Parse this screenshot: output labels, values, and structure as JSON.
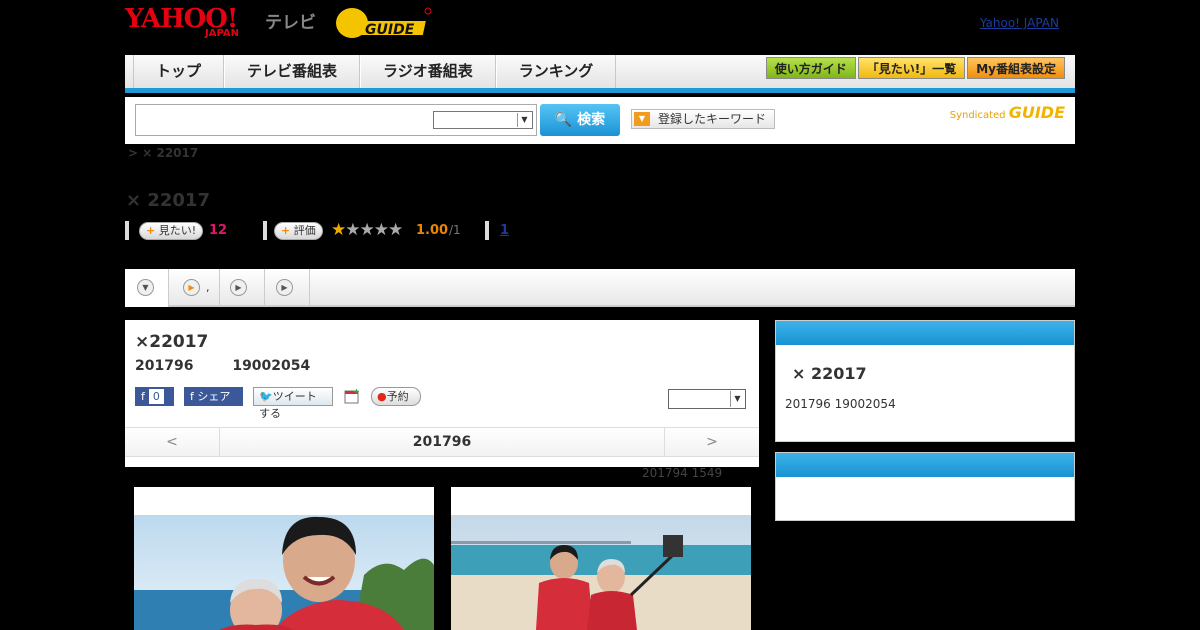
{
  "header": {
    "yahoo_logo": "YAHOO!",
    "japan_logo": "JAPAN",
    "tv_label": "テレビ",
    "gguide_logo": "GUIDE",
    "yahoo_japan_link": "Yahoo! JAPAN"
  },
  "nav": {
    "items": [
      {
        "label": "トップ"
      },
      {
        "label": "テレビ番組表"
      },
      {
        "label": "ラジオ番組表"
      },
      {
        "label": "ランキング"
      }
    ],
    "buttons": [
      {
        "label": "使い方ガイド"
      },
      {
        "label": "「見たい!」一覧"
      },
      {
        "label": "My番組表設定"
      }
    ]
  },
  "search": {
    "value": "",
    "select_value": "",
    "button_label": "検索",
    "keyword_button": "登録したキーワード",
    "syndicated_label": "Syndicated",
    "syndicated_logo": "GUIDE"
  },
  "breadcrumb": "> × 22017",
  "program": {
    "title": "× 22017",
    "want_label": "見たい!",
    "want_count": "12",
    "rate_label": "評価",
    "stars_on": 1,
    "stars_total": 5,
    "score": "1.00",
    "score_den": "/1",
    "review_count": "1"
  },
  "tabs": [
    {
      "label": ""
    },
    {
      "label": ","
    },
    {
      "label": ""
    },
    {
      "label": ""
    }
  ],
  "episode": {
    "title": "×22017",
    "date": "201796",
    "id": "19002054",
    "fb_like": "0",
    "fb_share": "シェア",
    "tweet": "ツイートする",
    "reserve": "予約",
    "select_value": "",
    "prev": "<",
    "current": "201796",
    "next": ">",
    "airtime": "201794  1549"
  },
  "sidebar": {
    "title": "× 22017",
    "meta": "201796  19002054"
  },
  "colors": {
    "accent_blue": "#1d9ad6",
    "want_count": "#e3156c",
    "score": "#e98800"
  }
}
